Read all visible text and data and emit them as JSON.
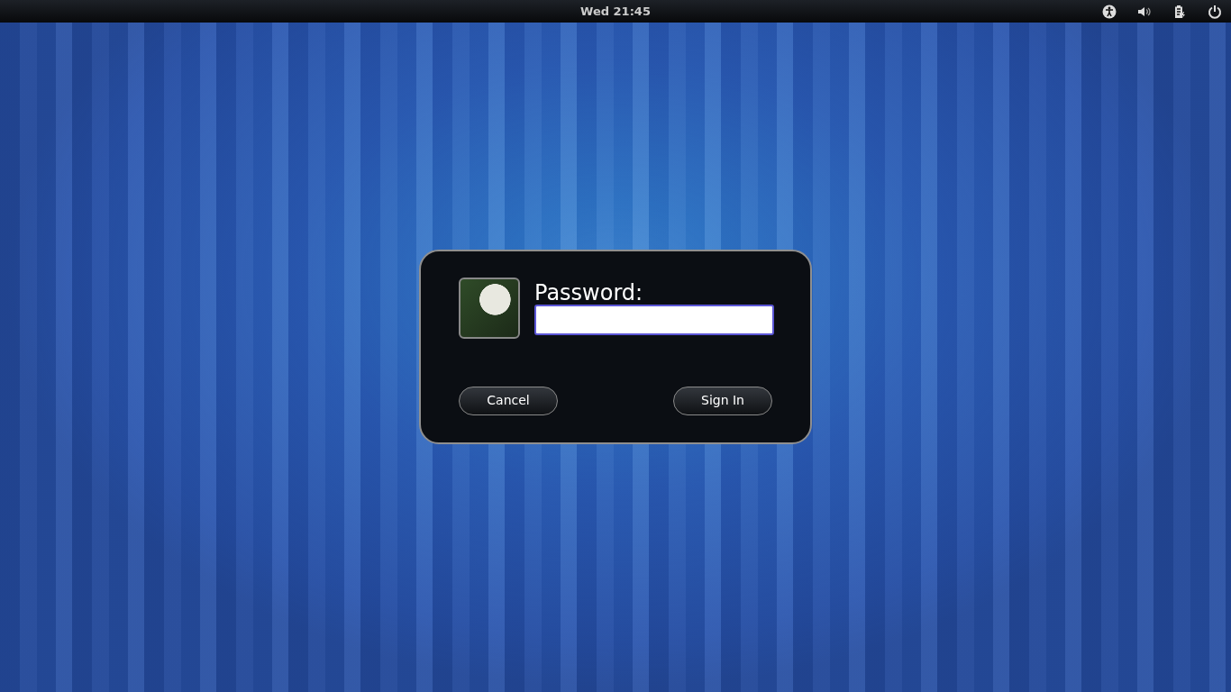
{
  "top_bar": {
    "clock": "Wed 21:45"
  },
  "login_dialog": {
    "prompt": "Password:",
    "password_field": {
      "focused": true
    },
    "buttons": [
      {
        "label": "Cancel"
      },
      {
        "label": "Sign In"
      }
    ]
  }
}
